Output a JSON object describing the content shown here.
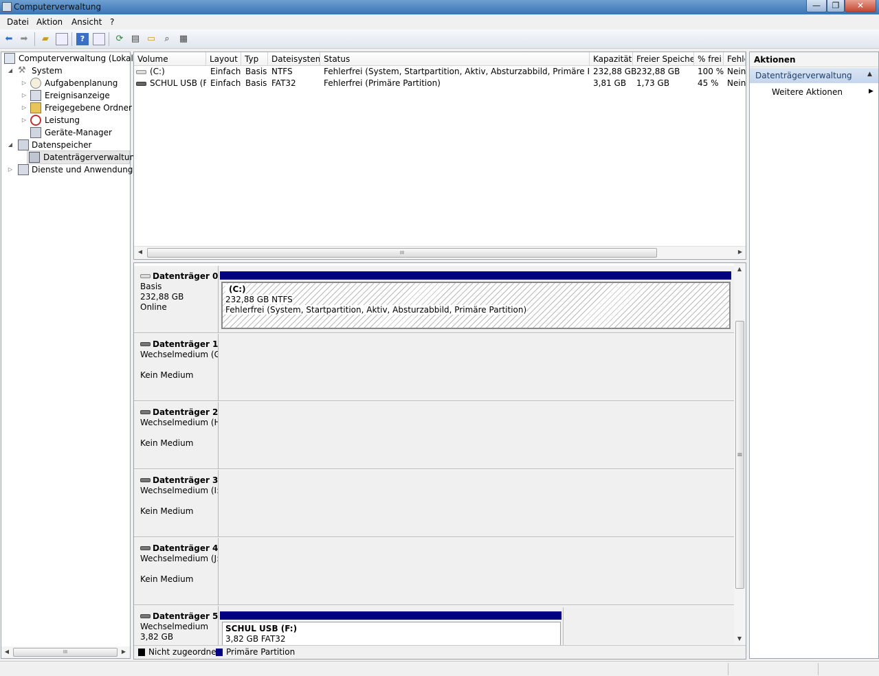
{
  "window": {
    "title": "Computerverwaltung",
    "minimize_glyph": "—",
    "restore_glyph": "❐",
    "close_glyph": "✕"
  },
  "menu": {
    "items": [
      "Datei",
      "Aktion",
      "Ansicht",
      "?"
    ]
  },
  "toolbar": {
    "icons": [
      "back-icon",
      "forward-icon",
      "up-folder-icon",
      "show-tree-icon",
      "help-icon",
      "show-action-pane-icon",
      "refresh-icon",
      "properties-icon",
      "open-icon",
      "rescan-icon",
      "settings-icon"
    ]
  },
  "tree": {
    "root": "Computerverwaltung (Lokal)",
    "system": "System",
    "aufgabenplanung": "Aufgabenplanung",
    "ereignisanzeige": "Ereignisanzeige",
    "freigegebene_ordner": "Freigegebene Ordner",
    "leistung": "Leistung",
    "geraete_manager": "Geräte-Manager",
    "datenspeicher": "Datenspeicher",
    "datentraegerverwaltung": "Datenträgerverwaltung",
    "dienste": "Dienste und Anwendungen"
  },
  "volumes": {
    "columns": [
      "Volume",
      "Layout",
      "Typ",
      "Dateisystem",
      "Status",
      "Kapazität",
      "Freier Speicher",
      "% frei",
      "Fehle"
    ],
    "rows": [
      [
        "(C:)",
        "Einfach",
        "Basis",
        "NTFS",
        "Fehlerfrei (System, Startpartition, Aktiv, Absturzabbild, Primäre Partition)",
        "232,88 GB",
        "232,88 GB",
        "100 %",
        "Nein"
      ],
      [
        "SCHUL USB (F:)",
        "Einfach",
        "Basis",
        "FAT32",
        "Fehlerfrei (Primäre Partition)",
        "3,81 GB",
        "1,73 GB",
        "45 %",
        "Nein"
      ]
    ]
  },
  "disks": [
    {
      "name": "Datenträger 0",
      "line1": "Basis",
      "line2": "232,88 GB",
      "line3": "Online",
      "partition": {
        "title": "(C:)",
        "size": "232,88 GB NTFS",
        "status": "Fehlerfrei (System, Startpartition, Aktiv, Absturzabbild, Primäre Partition)"
      }
    },
    {
      "name": "Datenträger 1",
      "line1": "Wechselmedium (G:",
      "line2": "",
      "line3": "Kein Medium"
    },
    {
      "name": "Datenträger 2",
      "line1": "Wechselmedium (H:",
      "line2": "",
      "line3": "Kein Medium"
    },
    {
      "name": "Datenträger 3",
      "line1": "Wechselmedium (I:)",
      "line2": "",
      "line3": "Kein Medium"
    },
    {
      "name": "Datenträger 4",
      "line1": "Wechselmedium (J:)",
      "line2": "",
      "line3": "Kein Medium"
    },
    {
      "name": "Datenträger 5",
      "line1": "Wechselmedium",
      "line2": "3,82 GB",
      "line3": "",
      "partition": {
        "title": "SCHUL USB  (F:)",
        "size": "3,82 GB FAT32",
        "status": ""
      }
    }
  ],
  "legend": {
    "unallocated": "Nicht zugeordnet",
    "primary": "Primäre Partition",
    "unallocated_color": "#000000",
    "primary_color": "#000080"
  },
  "actions": {
    "header": "Aktionen",
    "section": "Datenträgerverwaltung",
    "more": "Weitere Aktionen"
  },
  "scroll_glyphs": {
    "left": "◀",
    "right": "▶",
    "up": "▲",
    "down": "▼",
    "grip": "III",
    "grip_v": "≡"
  }
}
